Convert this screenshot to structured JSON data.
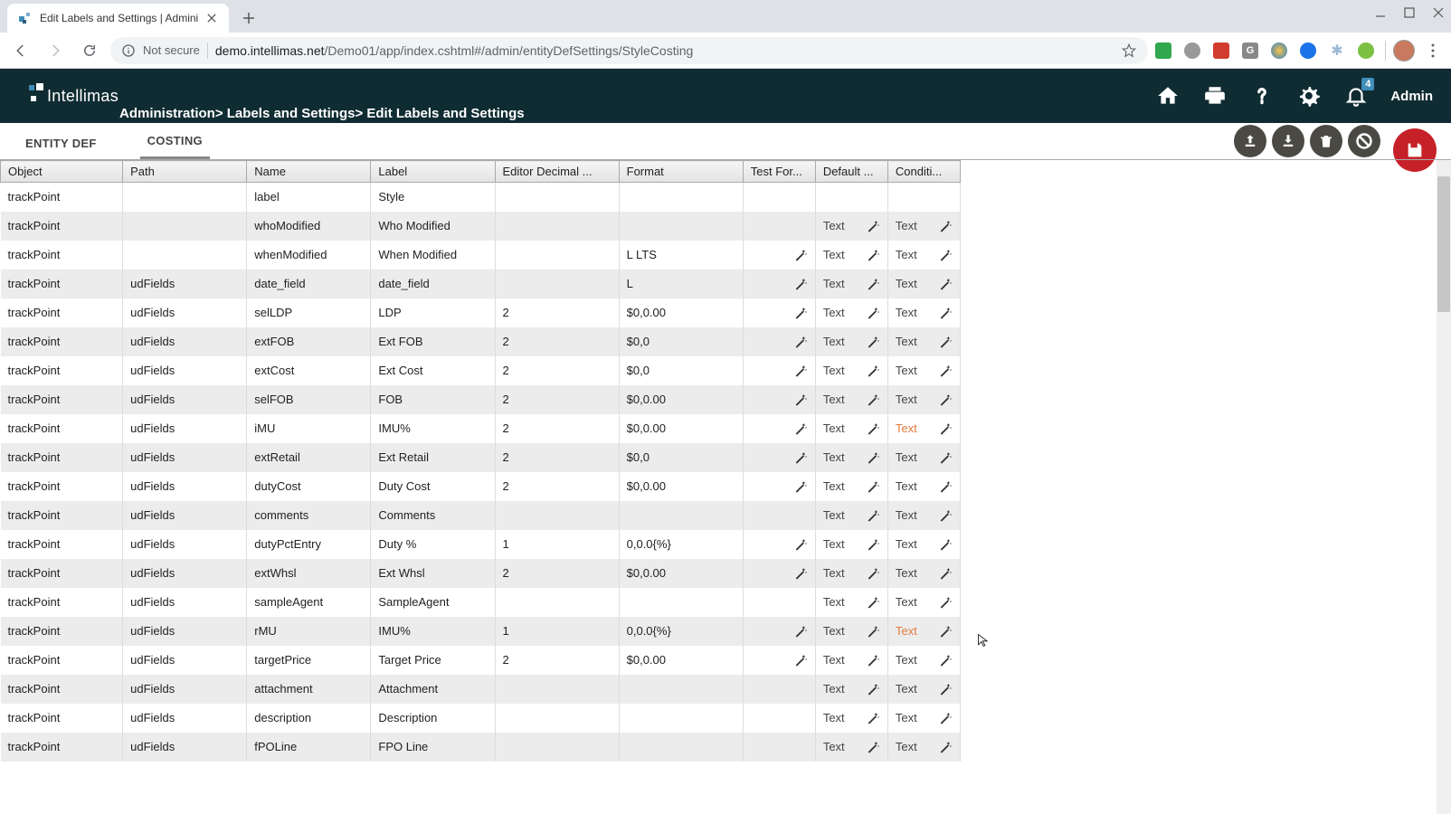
{
  "browser": {
    "tab_title": "Edit Labels and Settings | Admini",
    "not_secure": "Not secure",
    "url_host": "demo.intellimas.net",
    "url_path": "/Demo01/app/index.cshtml#/admin/entityDefSettings/StyleCosting"
  },
  "header": {
    "logo_text": "Intellimas",
    "breadcrumb": "Administration> Labels and Settings> Edit Labels and Settings",
    "notification_count": "4",
    "admin_label": "Admin"
  },
  "tabs": {
    "entity_def": "ENTITY DEF",
    "costing": "COSTING"
  },
  "columns": {
    "object": "Object",
    "path": "Path",
    "name": "Name",
    "label": "Label",
    "decimal": "Editor Decimal ...",
    "format": "Format",
    "test": "Test For...",
    "default": "Default ...",
    "cond": "Conditi..."
  },
  "text_label": "Text",
  "rows": [
    {
      "object": "trackPoint",
      "path": "",
      "name": "label",
      "label": "Style",
      "decimal": "",
      "format": "",
      "test": "",
      "default": "",
      "cond": ""
    },
    {
      "object": "trackPoint",
      "path": "",
      "name": "whoModified",
      "label": "Who Modified",
      "decimal": "",
      "format": "",
      "test": "",
      "default": "Text",
      "cond": "Text"
    },
    {
      "object": "trackPoint",
      "path": "",
      "name": "whenModified",
      "label": "When Modified",
      "decimal": "",
      "format": "L LTS",
      "test": "wand",
      "default": "Text",
      "cond": "Text"
    },
    {
      "object": "trackPoint",
      "path": "udFields",
      "name": "date_field",
      "label": "date_field",
      "decimal": "",
      "format": "L",
      "test": "wand",
      "default": "Text",
      "cond": "Text"
    },
    {
      "object": "trackPoint",
      "path": "udFields",
      "name": "selLDP",
      "label": "LDP",
      "decimal": "2",
      "format": "$0,0.00",
      "test": "wand",
      "default": "Text",
      "cond": "Text"
    },
    {
      "object": "trackPoint",
      "path": "udFields",
      "name": "extFOB",
      "label": "Ext FOB",
      "decimal": "2",
      "format": "$0,0",
      "test": "wand",
      "default": "Text",
      "cond": "Text"
    },
    {
      "object": "trackPoint",
      "path": "udFields",
      "name": "extCost",
      "label": "Ext Cost",
      "decimal": "2",
      "format": "$0,0",
      "test": "wand",
      "default": "Text",
      "cond": "Text"
    },
    {
      "object": "trackPoint",
      "path": "udFields",
      "name": "selFOB",
      "label": "FOB",
      "decimal": "2",
      "format": "$0,0.00",
      "test": "wand",
      "default": "Text",
      "cond": "Text"
    },
    {
      "object": "trackPoint",
      "path": "udFields",
      "name": "iMU",
      "label": "IMU%",
      "decimal": "2",
      "format": "$0,0.00",
      "test": "wand",
      "default": "Text",
      "cond": "Text",
      "cond_hl": true
    },
    {
      "object": "trackPoint",
      "path": "udFields",
      "name": "extRetail",
      "label": "Ext Retail",
      "decimal": "2",
      "format": "$0,0",
      "test": "wand",
      "default": "Text",
      "cond": "Text"
    },
    {
      "object": "trackPoint",
      "path": "udFields",
      "name": "dutyCost",
      "label": "Duty Cost",
      "decimal": "2",
      "format": "$0,0.00",
      "test": "wand",
      "default": "Text",
      "cond": "Text"
    },
    {
      "object": "trackPoint",
      "path": "udFields",
      "name": "comments",
      "label": "Comments",
      "decimal": "",
      "format": "",
      "test": "",
      "default": "Text",
      "cond": "Text"
    },
    {
      "object": "trackPoint",
      "path": "udFields",
      "name": "dutyPctEntry",
      "label": "Duty %",
      "decimal": "1",
      "format": "0,0.0{%}",
      "test": "wand",
      "default": "Text",
      "cond": "Text"
    },
    {
      "object": "trackPoint",
      "path": "udFields",
      "name": "extWhsl",
      "label": "Ext Whsl",
      "decimal": "2",
      "format": "$0,0.00",
      "test": "wand",
      "default": "Text",
      "cond": "Text"
    },
    {
      "object": "trackPoint",
      "path": "udFields",
      "name": "sampleAgent",
      "label": "SampleAgent",
      "decimal": "",
      "format": "",
      "test": "",
      "default": "Text",
      "cond": "Text"
    },
    {
      "object": "trackPoint",
      "path": "udFields",
      "name": "rMU",
      "label": "IMU%",
      "decimal": "1",
      "format": "0,0.0{%}",
      "test": "wand",
      "default": "Text",
      "cond": "Text",
      "cond_hl": true
    },
    {
      "object": "trackPoint",
      "path": "udFields",
      "name": "targetPrice",
      "label": "Target Price",
      "decimal": "2",
      "format": "$0,0.00",
      "test": "wand",
      "default": "Text",
      "cond": "Text"
    },
    {
      "object": "trackPoint",
      "path": "udFields",
      "name": "attachment",
      "label": "Attachment",
      "decimal": "",
      "format": "",
      "test": "",
      "default": "Text",
      "cond": "Text"
    },
    {
      "object": "trackPoint",
      "path": "udFields",
      "name": "description",
      "label": "Description",
      "decimal": "",
      "format": "",
      "test": "",
      "default": "Text",
      "cond": "Text"
    },
    {
      "object": "trackPoint",
      "path": "udFields",
      "name": "fPOLine",
      "label": "FPO Line",
      "decimal": "",
      "format": "",
      "test": "",
      "default": "Text",
      "cond": "Text"
    }
  ]
}
